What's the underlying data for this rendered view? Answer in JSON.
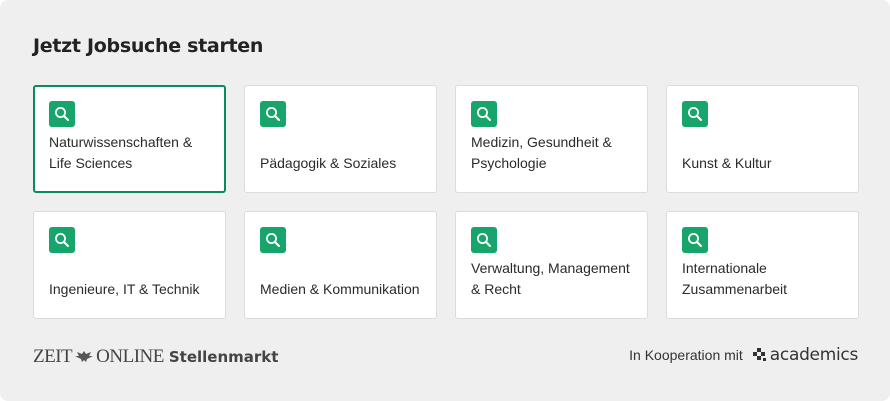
{
  "widget": {
    "title": "Jetzt Jobsuche starten"
  },
  "categories": [
    {
      "label": "Naturwissenschaften & Life Sciences",
      "icon": "search-icon",
      "active": true
    },
    {
      "label": "Pädagogik & Soziales",
      "icon": "search-icon",
      "active": false
    },
    {
      "label": "Medizin, Gesundheit & Psychologie",
      "icon": "search-icon",
      "active": false
    },
    {
      "label": "Kunst & Kultur",
      "icon": "search-icon",
      "active": false
    },
    {
      "label": "Ingenieure, IT & Technik",
      "icon": "search-icon",
      "active": false
    },
    {
      "label": "Medien & Kommunikation",
      "icon": "search-icon",
      "active": false
    },
    {
      "label": "Verwaltung, Management & Recht",
      "icon": "search-icon",
      "active": false
    },
    {
      "label": "Internationale Zusammenarbeit",
      "icon": "search-icon",
      "active": false
    }
  ],
  "footer": {
    "brand_zeit": "ZEIT",
    "brand_online": "ONLINE",
    "brand_stellenmarkt": "Stellenmarkt",
    "cooperation_text": "In Kooperation mit",
    "partner_name": "academics"
  },
  "colors": {
    "accent": "#17a56b",
    "active_border": "#0b8a5a",
    "background": "#efefef",
    "card": "#ffffff"
  }
}
